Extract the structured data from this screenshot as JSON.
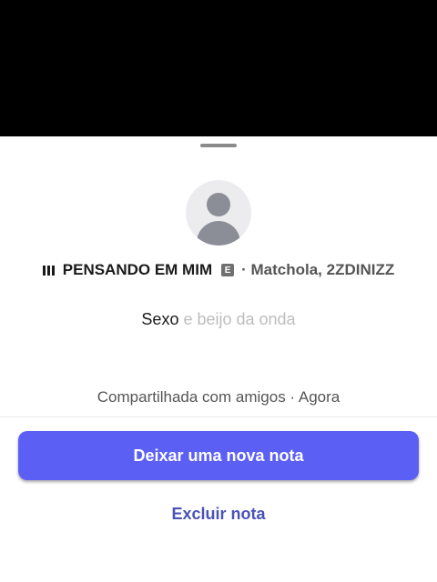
{
  "note": {
    "track": {
      "title": "PENSANDO EM MIM",
      "explicit_badge": "E",
      "meta": "· Matchola, 2ZDINIZZ"
    },
    "text_main": "Sexo",
    "text_faded": " e beijo da onda",
    "shared_info": "Compartilhada com amigos · Agora"
  },
  "actions": {
    "new_note_label": "Deixar uma nova nota",
    "delete_note_label": "Excluir nota"
  },
  "colors": {
    "primary_button": "#5b5ff4",
    "link": "#4a52b8"
  }
}
